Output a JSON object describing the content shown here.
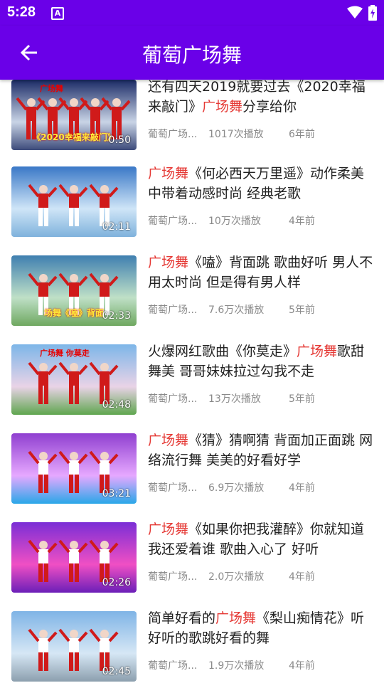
{
  "status": {
    "time": "5:28",
    "indicator": "A"
  },
  "app_bar": {
    "title": "葡萄广场舞"
  },
  "colors": {
    "primary": "#6a00e8",
    "highlight": "#e53935"
  },
  "items": [
    {
      "title_before": "还有四天2019就要过去《2020幸福来敲门》",
      "title_hl": "广场舞",
      "title_after": "分享给你",
      "channel": "葡萄广场...",
      "plays": "1017次播放",
      "age": "6年前",
      "duration": "0:50",
      "thumb_caption": "《2020幸福来敲门》",
      "thumb_top": "广场舞"
    },
    {
      "title_before": "",
      "title_hl": "广场舞",
      "title_after": "《何必西天万里遥》动作柔美中带着动感时尚 经典老歌",
      "channel": "葡萄广场...",
      "plays": "10万次播放",
      "age": "4年前",
      "duration": "02:11",
      "thumb_caption": "",
      "thumb_top": ""
    },
    {
      "title_before": "",
      "title_hl": "广场舞",
      "title_after": "《嗑》背面跳 歌曲好听 男人不用太时尚 但是得有男人样",
      "channel": "葡萄广场...",
      "plays": "7.6万次播放",
      "age": "5年前",
      "duration": "02:33",
      "thumb_caption": "场舞《嗑》背面",
      "thumb_top": ""
    },
    {
      "title_before": "火爆网红歌曲《你莫走》",
      "title_hl": "广场舞",
      "title_after": "歌甜舞美 哥哥妹妹拉过勾我不走",
      "channel": "葡萄广场...",
      "plays": "13万次播放",
      "age": "5年前",
      "duration": "02:48",
      "thumb_caption": "",
      "thumb_top": "广场舞 你莫走"
    },
    {
      "title_before": "",
      "title_hl": "广场舞",
      "title_after": "《猜》猜啊猜 背面加正面跳 网络流行舞 美美的好看好学",
      "channel": "葡萄广场...",
      "plays": "6.9万次播放",
      "age": "4年前",
      "duration": "03:21",
      "thumb_caption": "",
      "thumb_top": ""
    },
    {
      "title_before": "",
      "title_hl": "广场舞",
      "title_after": "《如果你把我灌醉》你就知道我还爱着谁 歌曲入心了 好听",
      "channel": "葡萄广场...",
      "plays": "2.0万次播放",
      "age": "4年前",
      "duration": "02:26",
      "thumb_caption": "",
      "thumb_top": ""
    },
    {
      "title_before": "简单好看的",
      "title_hl": "广场舞",
      "title_after": "《梨山痴情花》听好听的歌跳好看的舞",
      "channel": "葡萄广场...",
      "plays": "1.9万次播放",
      "age": "4年前",
      "duration": "02:45",
      "thumb_caption": "",
      "thumb_top": ""
    }
  ]
}
